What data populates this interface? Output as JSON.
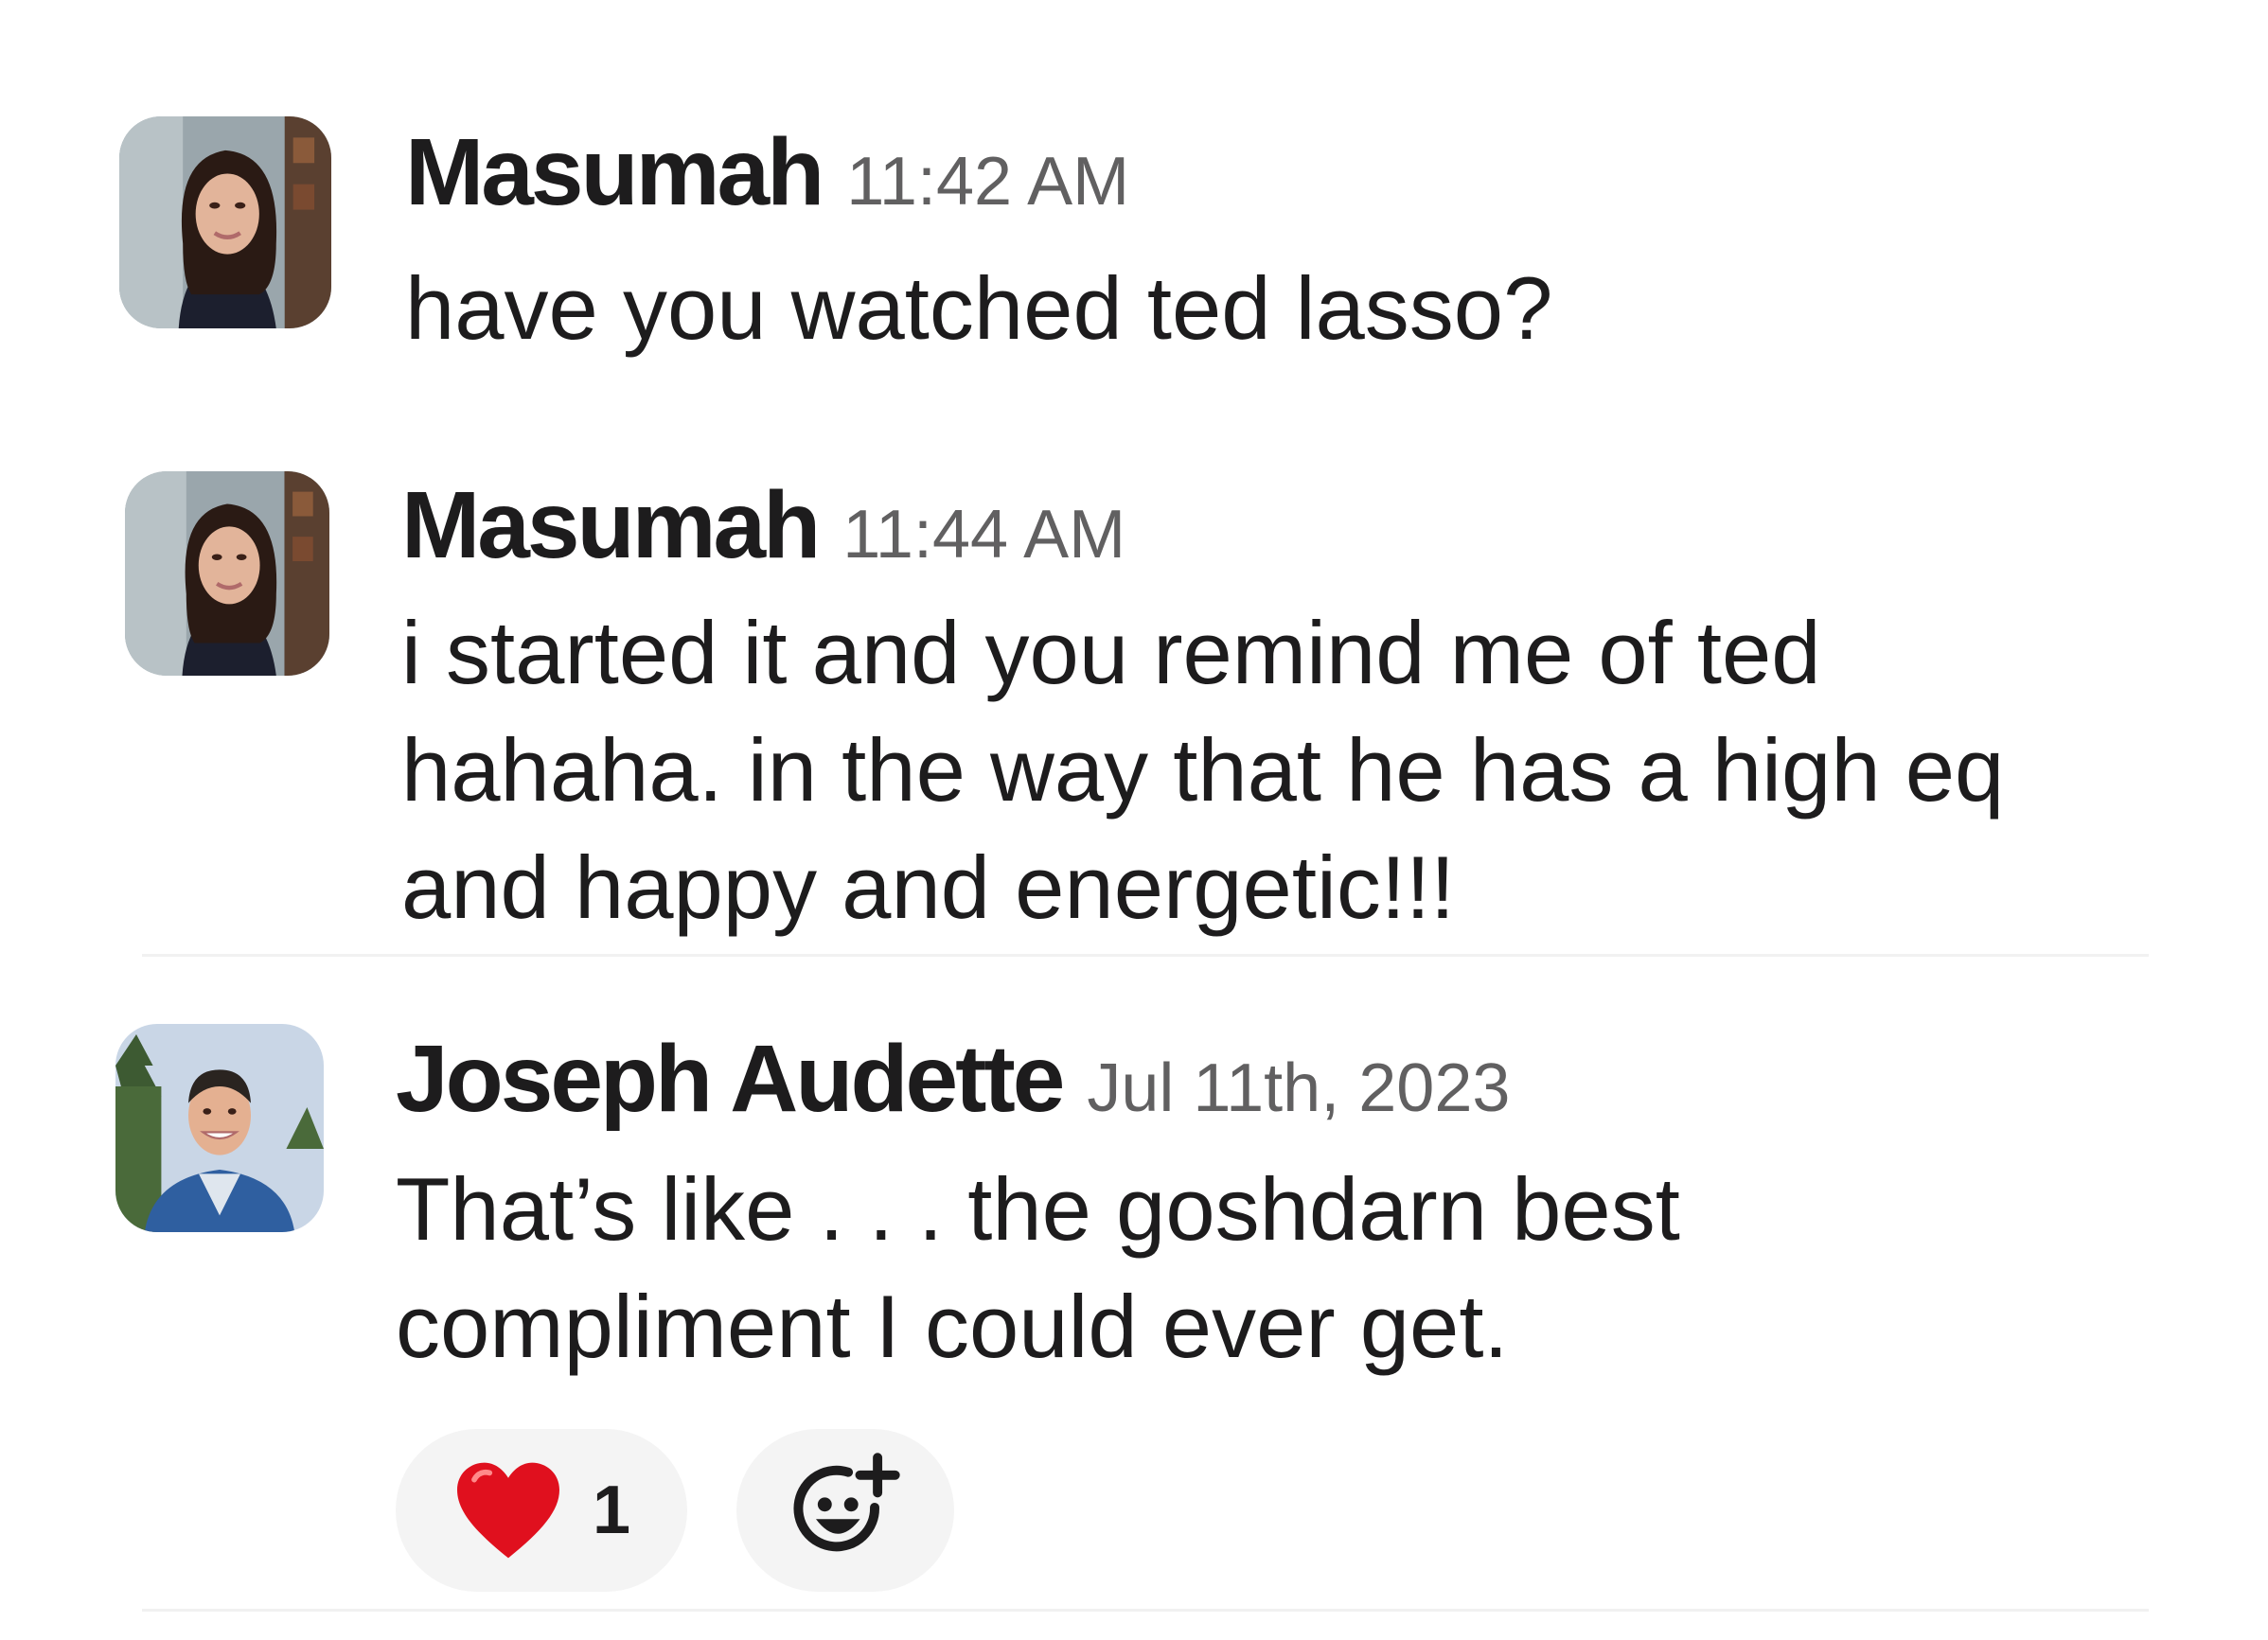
{
  "messages": [
    {
      "sender": "Masumah",
      "timestamp": "11:42 AM",
      "text": "have you watched ted lasso?"
    },
    {
      "sender": "Masumah",
      "timestamp": "11:44 AM",
      "text": "i started it and you remind me of ted\nhahaha. in the way that he has a high eq\nand happy and energetic!!!"
    },
    {
      "sender": "Joseph Audette",
      "timestamp": "Jul 11th, 2023",
      "text": "That’s like . . . the goshdarn best\ncompliment I could ever get."
    }
  ],
  "reactions": [
    {
      "emoji": "heart-emoji",
      "count": "1"
    }
  ],
  "icons": {
    "add_reaction": "add-reaction-icon"
  },
  "colors": {
    "text": "#1d1c1d",
    "timestamp": "#616061",
    "reaction_bg": "#f4f4f4",
    "heart": "#e0101e"
  }
}
